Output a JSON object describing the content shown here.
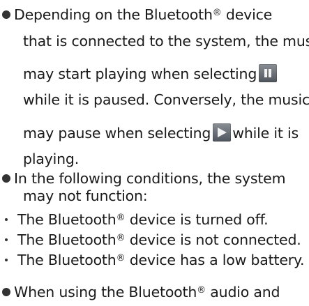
{
  "register_mark": "®",
  "icons": {
    "pause": "pause-icon",
    "play": "play-icon"
  },
  "bullet1": {
    "l1_a": "Depending on the Bluetooth",
    "l1_b": " device",
    "l2": "that is connected to the system, the music",
    "l3": "may start playing when selecting",
    "l4": "while it is paused. Conversely, the music",
    "l5_a": "may pause when selecting",
    "l5_b": "while it is",
    "l6": "playing."
  },
  "bullet2": {
    "l1": "In the following conditions, the system",
    "l2": "may not function:",
    "sub1_a": "The Bluetooth",
    "sub1_b": " device is turned off.",
    "sub2_a": "The Bluetooth",
    "sub2_b": " device is not connected.",
    "sub3_a": "The Bluetooth",
    "sub3_b": " device has a low battery."
  },
  "bullet3": {
    "l1_a": "When using the Bluetooth",
    "l1_b": " audio and"
  }
}
